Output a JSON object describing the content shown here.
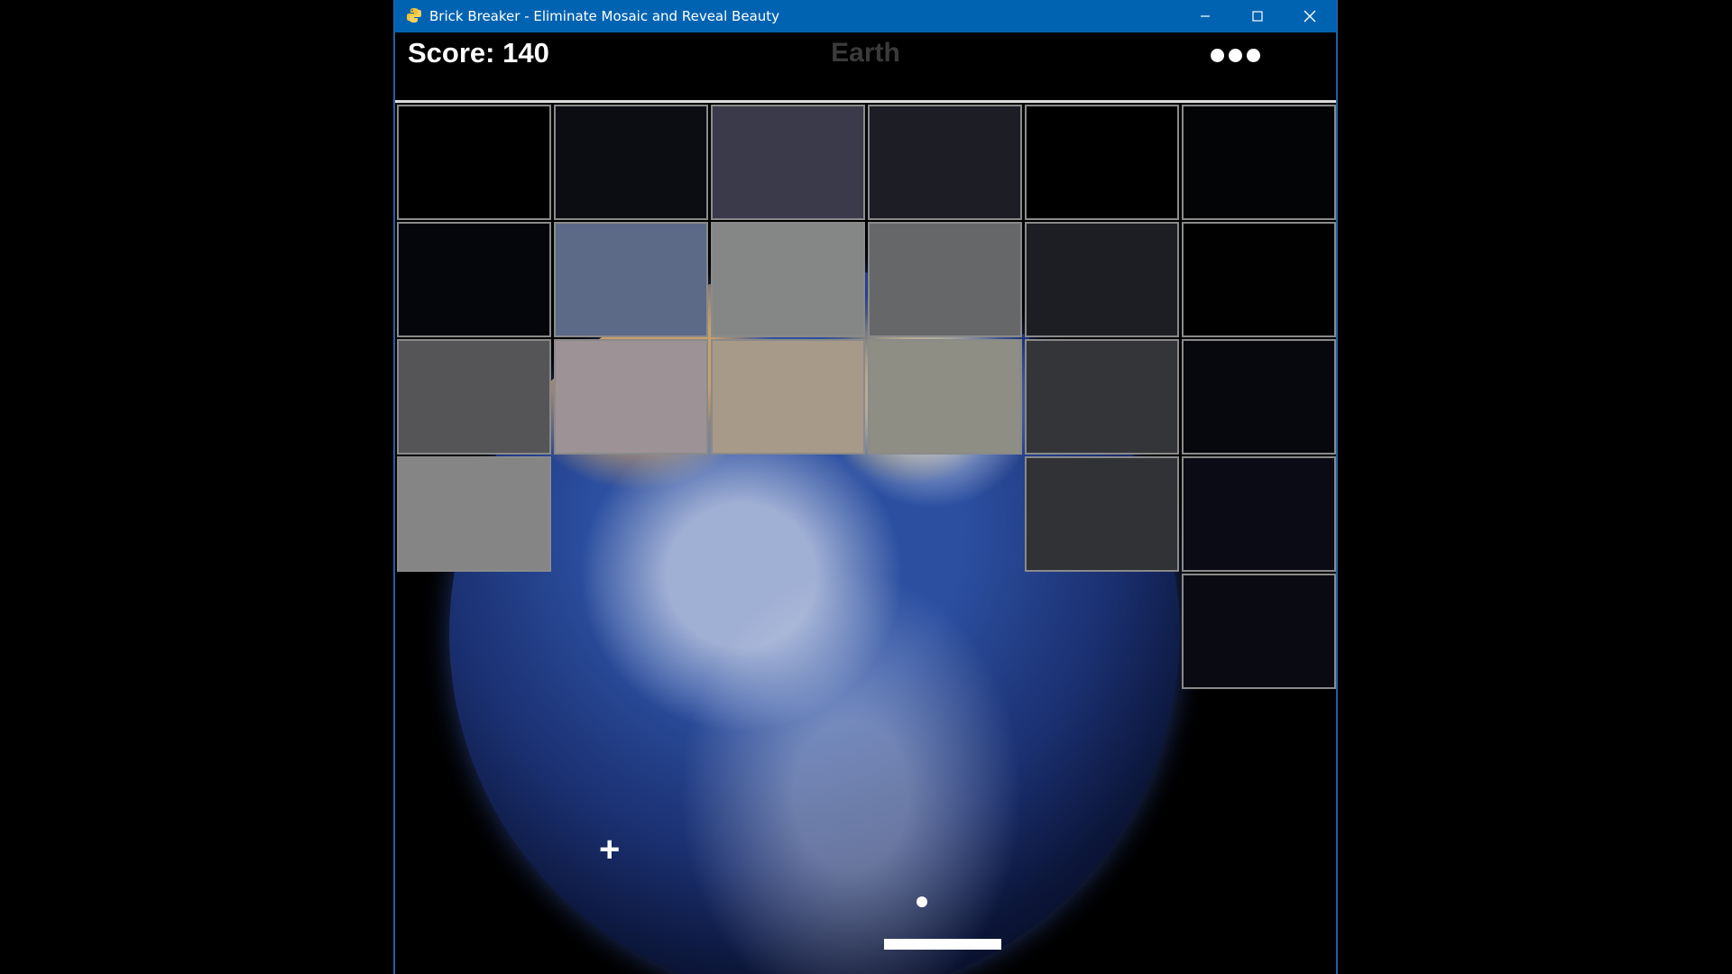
{
  "window": {
    "title": "Brick Breaker - Eliminate Mosaic and Reveal Beauty",
    "icon": "python-icon",
    "controls": [
      "minimize-icon",
      "maximize-icon",
      "close-icon"
    ],
    "titlebar_color": "#0063b1"
  },
  "hud": {
    "score_text": "Score: 140",
    "level_name": "Earth",
    "menu_icon": "more-dots-icon"
  },
  "board": {
    "background_image": "earth-from-space",
    "bricks": [
      {
        "row": 0,
        "col": 0,
        "color": "#000000"
      },
      {
        "row": 0,
        "col": 1,
        "color": "#0b0d12"
      },
      {
        "row": 0,
        "col": 2,
        "color": "#3a3a4a"
      },
      {
        "row": 0,
        "col": 3,
        "color": "#1d1e25"
      },
      {
        "row": 0,
        "col": 4,
        "color": "#000000"
      },
      {
        "row": 0,
        "col": 5,
        "color": "#030406"
      },
      {
        "row": 1,
        "col": 0,
        "color": "#05060c"
      },
      {
        "row": 1,
        "col": 1,
        "color": "#5c6a88"
      },
      {
        "row": 1,
        "col": 2,
        "color": "#858787"
      },
      {
        "row": 1,
        "col": 3,
        "color": "#666769"
      },
      {
        "row": 1,
        "col": 4,
        "color": "#1d1e23"
      },
      {
        "row": 1,
        "col": 5,
        "color": "#010102"
      },
      {
        "row": 2,
        "col": 0,
        "color": "#555558"
      },
      {
        "row": 2,
        "col": 1,
        "color": "#9d9396"
      },
      {
        "row": 2,
        "col": 2,
        "color": "#a89a88"
      },
      {
        "row": 2,
        "col": 3,
        "color": "#8e8e84"
      },
      {
        "row": 2,
        "col": 4,
        "color": "#333538"
      },
      {
        "row": 2,
        "col": 5,
        "color": "#07080d"
      },
      {
        "row": 3,
        "col": 0,
        "color": "#858585"
      },
      {
        "row": 3,
        "col": 4,
        "color": "#303236"
      },
      {
        "row": 3,
        "col": 5,
        "color": "#0a0b14"
      },
      {
        "row": 4,
        "col": 5,
        "color": "#0a0b12"
      }
    ],
    "cursor_icon": "plus-cursor-icon"
  }
}
